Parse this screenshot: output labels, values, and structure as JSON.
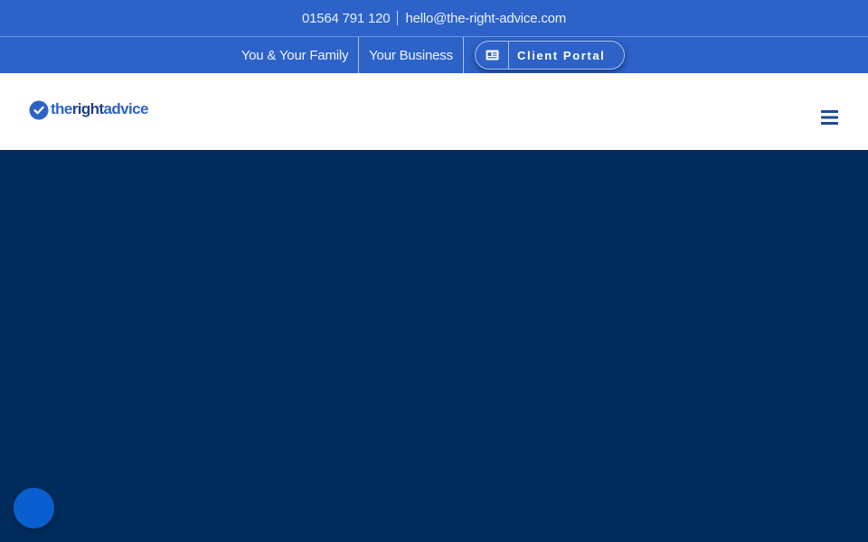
{
  "topbar": {
    "phone": "01564 791 120",
    "email": "hello@the-right-advice.com"
  },
  "nav": {
    "items": [
      {
        "label": "You & Your Family"
      },
      {
        "label": "Your Business"
      }
    ],
    "portal": {
      "label": "Client Portal",
      "icon": "id-card-icon"
    }
  },
  "header": {
    "logo": {
      "word1": "the",
      "word2": "right",
      "word3": "advice",
      "icon": "checkmark-circle-icon"
    },
    "menu_icon": "hamburger-menu-icon"
  },
  "colors": {
    "topbar": "#2d63c8",
    "hero": "#002d5e",
    "header": "#ffffff",
    "chat_button": "#0a5fd0"
  },
  "chat": {
    "icon": "chat-bubble-icon"
  }
}
